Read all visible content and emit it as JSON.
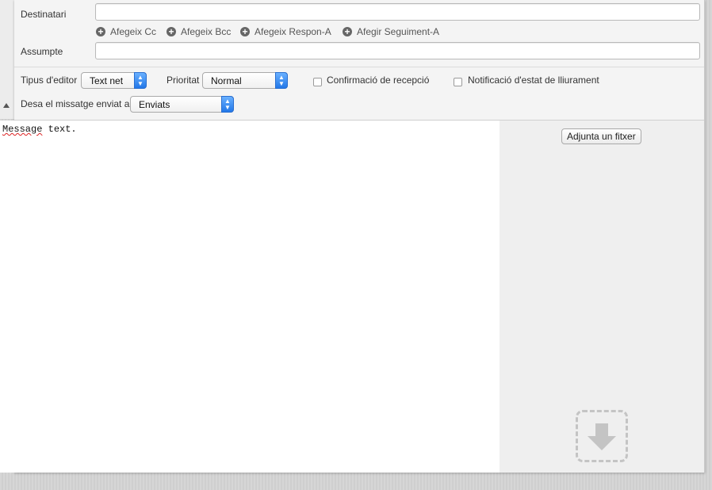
{
  "header": {
    "to_label": "Destinatari",
    "to_value": "",
    "subject_label": "Assumpte",
    "subject_value": "",
    "add_links": [
      {
        "label": "Afegeix Cc",
        "icon": "plus-circle-icon"
      },
      {
        "label": "Afegeix Bcc",
        "icon": "plus-circle-icon"
      },
      {
        "label": "Afegeix Respon-A",
        "icon": "plus-circle-icon"
      },
      {
        "label": "Afegir Seguiment-A",
        "icon": "plus-circle-icon"
      }
    ]
  },
  "options": {
    "editor_type_label": "Tipus d'editor",
    "editor_type_value": "Text net",
    "priority_label": "Prioritat",
    "priority_value": "Normal",
    "read_receipt_label": "Confirmació de recepció",
    "read_receipt_checked": false,
    "delivery_status_label": "Notificació d'estat de lliurament",
    "delivery_status_checked": false,
    "save_sent_label": "Desa el missatge enviat a",
    "save_sent_value": "Enviats"
  },
  "editor": {
    "word1": "Message",
    "word2": " text."
  },
  "attachments": {
    "button_label": "Adjunta un fitxer",
    "drop_icon": "download-arrow-icon"
  },
  "colors": {
    "select_accent": "#2277e8",
    "spellcheck_underline": "#dd2222"
  }
}
